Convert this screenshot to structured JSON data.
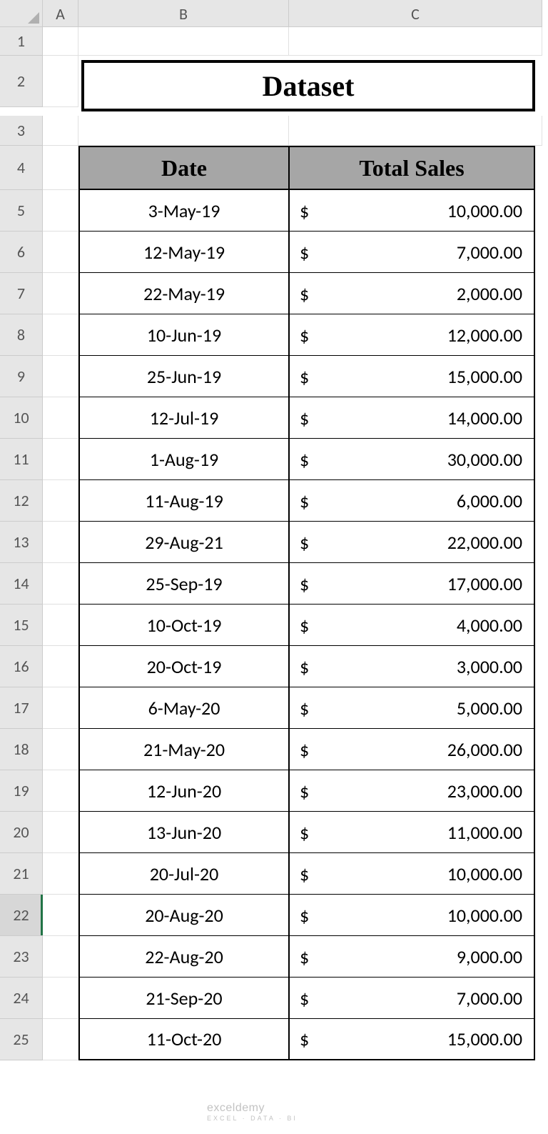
{
  "columns": [
    "A",
    "B",
    "C"
  ],
  "rowNumbers": [
    "1",
    "2",
    "3",
    "4",
    "5",
    "6",
    "7",
    "8",
    "9",
    "10",
    "11",
    "12",
    "13",
    "14",
    "15",
    "16",
    "17",
    "18",
    "19",
    "20",
    "21",
    "22",
    "23",
    "24",
    "25"
  ],
  "activeRow": "22",
  "title": "Dataset",
  "headers": {
    "date": "Date",
    "total": "Total Sales"
  },
  "currency": "$",
  "rows": [
    {
      "date": "3-May-19",
      "sales": "10,000.00"
    },
    {
      "date": "12-May-19",
      "sales": "7,000.00"
    },
    {
      "date": "22-May-19",
      "sales": "2,000.00"
    },
    {
      "date": "10-Jun-19",
      "sales": "12,000.00"
    },
    {
      "date": "25-Jun-19",
      "sales": "15,000.00"
    },
    {
      "date": "12-Jul-19",
      "sales": "14,000.00"
    },
    {
      "date": "1-Aug-19",
      "sales": "30,000.00"
    },
    {
      "date": "11-Aug-19",
      "sales": "6,000.00"
    },
    {
      "date": "29-Aug-21",
      "sales": "22,000.00"
    },
    {
      "date": "25-Sep-19",
      "sales": "17,000.00"
    },
    {
      "date": "10-Oct-19",
      "sales": "4,000.00"
    },
    {
      "date": "20-Oct-19",
      "sales": "3,000.00"
    },
    {
      "date": "6-May-20",
      "sales": "5,000.00"
    },
    {
      "date": "21-May-20",
      "sales": "26,000.00"
    },
    {
      "date": "12-Jun-20",
      "sales": "23,000.00"
    },
    {
      "date": "13-Jun-20",
      "sales": "11,000.00"
    },
    {
      "date": "20-Jul-20",
      "sales": "10,000.00"
    },
    {
      "date": "20-Aug-20",
      "sales": "10,000.00"
    },
    {
      "date": "22-Aug-20",
      "sales": "9,000.00"
    },
    {
      "date": "21-Sep-20",
      "sales": "7,000.00"
    },
    {
      "date": "11-Oct-20",
      "sales": "15,000.00"
    }
  ],
  "watermark": {
    "line1": "exceldemy",
    "line2": "EXCEL · DATA · BI"
  }
}
